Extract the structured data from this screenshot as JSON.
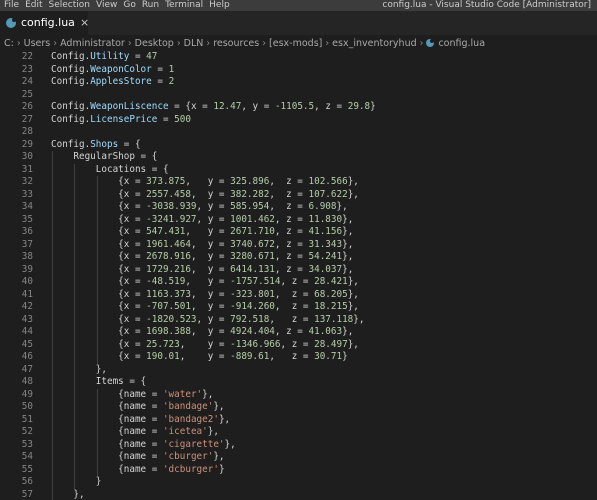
{
  "menu": [
    "File",
    "Edit",
    "Selection",
    "View",
    "Go",
    "Run",
    "Terminal",
    "Help"
  ],
  "window_title": "config.lua - Visual Studio Code [Administrator]",
  "tab": {
    "label": "config.lua",
    "close": "×"
  },
  "breadcrumb": [
    "C:",
    "Users",
    "Administrator",
    "Desktop",
    "DLN",
    "resources",
    "[esx-mods]",
    "esx_inventoryhud",
    "config.lua"
  ],
  "code_lines": [
    {
      "n": "22",
      "code": [
        [
          "k",
          "Config."
        ],
        [
          "p",
          "Utility"
        ],
        [
          "k",
          " = "
        ],
        [
          "n",
          "47"
        ]
      ]
    },
    {
      "n": "23",
      "code": [
        [
          "k",
          "Config."
        ],
        [
          "p",
          "WeaponColor"
        ],
        [
          "k",
          " = "
        ],
        [
          "n",
          "1"
        ]
      ]
    },
    {
      "n": "24",
      "code": [
        [
          "k",
          "Config."
        ],
        [
          "p",
          "ApplesStore"
        ],
        [
          "k",
          " = "
        ],
        [
          "n",
          "2"
        ]
      ]
    },
    {
      "n": "25",
      "code": []
    },
    {
      "n": "26",
      "code": [
        [
          "k",
          "Config."
        ],
        [
          "p",
          "WeaponLiscence"
        ],
        [
          "k",
          " = {x = "
        ],
        [
          "n",
          "12.47"
        ],
        [
          "k",
          ", y = "
        ],
        [
          "n",
          "-1105.5"
        ],
        [
          "k",
          ", z = "
        ],
        [
          "n",
          "29.8"
        ],
        [
          "k",
          "}"
        ]
      ]
    },
    {
      "n": "27",
      "code": [
        [
          "k",
          "Config."
        ],
        [
          "p",
          "LicensePrice"
        ],
        [
          "k",
          " = "
        ],
        [
          "n",
          "500"
        ]
      ]
    },
    {
      "n": "28",
      "code": []
    },
    {
      "n": "29",
      "code": [
        [
          "k",
          "Config."
        ],
        [
          "p",
          "Shops"
        ],
        [
          "k",
          " = {"
        ]
      ]
    },
    {
      "n": "30",
      "code": [
        [
          "k",
          "    RegularShop = {"
        ]
      ]
    },
    {
      "n": "31",
      "code": [
        [
          "k",
          "        Locations = {"
        ]
      ]
    },
    {
      "n": "32",
      "code": [
        [
          "k",
          "            {x = "
        ],
        [
          "n",
          "373.875"
        ],
        [
          "k",
          ",   y = "
        ],
        [
          "n",
          "325.896"
        ],
        [
          "k",
          ",  z = "
        ],
        [
          "n",
          "102.566"
        ],
        [
          "k",
          "},"
        ]
      ]
    },
    {
      "n": "33",
      "code": [
        [
          "k",
          "            {x = "
        ],
        [
          "n",
          "2557.458"
        ],
        [
          "k",
          ",  y = "
        ],
        [
          "n",
          "382.282"
        ],
        [
          "k",
          ",  z = "
        ],
        [
          "n",
          "107.622"
        ],
        [
          "k",
          "},"
        ]
      ]
    },
    {
      "n": "34",
      "code": [
        [
          "k",
          "            {x = "
        ],
        [
          "n",
          "-3038.939"
        ],
        [
          "k",
          ", y = "
        ],
        [
          "n",
          "585.954"
        ],
        [
          "k",
          ",  z = "
        ],
        [
          "n",
          "6.908"
        ],
        [
          "k",
          "},"
        ]
      ]
    },
    {
      "n": "35",
      "code": [
        [
          "k",
          "            {x = "
        ],
        [
          "n",
          "-3241.927"
        ],
        [
          "k",
          ", y = "
        ],
        [
          "n",
          "1001.462"
        ],
        [
          "k",
          ", z = "
        ],
        [
          "n",
          "11.830"
        ],
        [
          "k",
          "},"
        ]
      ]
    },
    {
      "n": "36",
      "code": [
        [
          "k",
          "            {x = "
        ],
        [
          "n",
          "547.431"
        ],
        [
          "k",
          ",   y = "
        ],
        [
          "n",
          "2671.710"
        ],
        [
          "k",
          ", z = "
        ],
        [
          "n",
          "41.156"
        ],
        [
          "k",
          "},"
        ]
      ]
    },
    {
      "n": "37",
      "code": [
        [
          "k",
          "            {x = "
        ],
        [
          "n",
          "1961.464"
        ],
        [
          "k",
          ",  y = "
        ],
        [
          "n",
          "3740.672"
        ],
        [
          "k",
          ", z = "
        ],
        [
          "n",
          "31.343"
        ],
        [
          "k",
          "},"
        ]
      ]
    },
    {
      "n": "38",
      "code": [
        [
          "k",
          "            {x = "
        ],
        [
          "n",
          "2678.916"
        ],
        [
          "k",
          ",  y = "
        ],
        [
          "n",
          "3280.671"
        ],
        [
          "k",
          ", z = "
        ],
        [
          "n",
          "54.241"
        ],
        [
          "k",
          "},"
        ]
      ]
    },
    {
      "n": "39",
      "code": [
        [
          "k",
          "            {x = "
        ],
        [
          "n",
          "1729.216"
        ],
        [
          "k",
          ",  y = "
        ],
        [
          "n",
          "6414.131"
        ],
        [
          "k",
          ", z = "
        ],
        [
          "n",
          "34.037"
        ],
        [
          "k",
          "},"
        ]
      ]
    },
    {
      "n": "40",
      "code": [
        [
          "k",
          "            {x = "
        ],
        [
          "n",
          "-48.519"
        ],
        [
          "k",
          ",   y = "
        ],
        [
          "n",
          "-1757.514"
        ],
        [
          "k",
          ", z = "
        ],
        [
          "n",
          "28.421"
        ],
        [
          "k",
          "},"
        ]
      ]
    },
    {
      "n": "41",
      "code": [
        [
          "k",
          "            {x = "
        ],
        [
          "n",
          "1163.373"
        ],
        [
          "k",
          ",  y = "
        ],
        [
          "n",
          "-323.801"
        ],
        [
          "k",
          ",  z = "
        ],
        [
          "n",
          "68.205"
        ],
        [
          "k",
          "},"
        ]
      ]
    },
    {
      "n": "42",
      "code": [
        [
          "k",
          "            {x = "
        ],
        [
          "n",
          "-707.501"
        ],
        [
          "k",
          ",  y = "
        ],
        [
          "n",
          "-914.260"
        ],
        [
          "k",
          ",  z = "
        ],
        [
          "n",
          "18.215"
        ],
        [
          "k",
          "},"
        ]
      ]
    },
    {
      "n": "43",
      "code": [
        [
          "k",
          "            {x = "
        ],
        [
          "n",
          "-1820.523"
        ],
        [
          "k",
          ", y = "
        ],
        [
          "n",
          "792.518"
        ],
        [
          "k",
          ",   z = "
        ],
        [
          "n",
          "137.118"
        ],
        [
          "k",
          "},"
        ]
      ]
    },
    {
      "n": "44",
      "code": [
        [
          "k",
          "            {x = "
        ],
        [
          "n",
          "1698.388"
        ],
        [
          "k",
          ",  y = "
        ],
        [
          "n",
          "4924.404"
        ],
        [
          "k",
          ", z = "
        ],
        [
          "n",
          "41.063"
        ],
        [
          "k",
          "},"
        ]
      ]
    },
    {
      "n": "45",
      "code": [
        [
          "k",
          "            {x = "
        ],
        [
          "n",
          "25.723"
        ],
        [
          "k",
          ",    y = "
        ],
        [
          "n",
          "-1346.966"
        ],
        [
          "k",
          ", z = "
        ],
        [
          "n",
          "28.497"
        ],
        [
          "k",
          "},"
        ]
      ]
    },
    {
      "n": "46",
      "code": [
        [
          "k",
          "            {x = "
        ],
        [
          "n",
          "190.01"
        ],
        [
          "k",
          ",    y = "
        ],
        [
          "n",
          "-889.61"
        ],
        [
          "k",
          ",   z = "
        ],
        [
          "n",
          "30.71"
        ],
        [
          "k",
          "}"
        ]
      ]
    },
    {
      "n": "47",
      "code": [
        [
          "k",
          "        },"
        ]
      ]
    },
    {
      "n": "48",
      "code": [
        [
          "k",
          "        Items = {"
        ]
      ]
    },
    {
      "n": "49",
      "code": [
        [
          "k",
          "            {name = "
        ],
        [
          "s",
          "'water'"
        ],
        [
          "k",
          "},"
        ]
      ]
    },
    {
      "n": "50",
      "code": [
        [
          "k",
          "            {name = "
        ],
        [
          "s",
          "'bandage'"
        ],
        [
          "k",
          "},"
        ]
      ]
    },
    {
      "n": "51",
      "code": [
        [
          "k",
          "            {name = "
        ],
        [
          "s",
          "'bandage2'"
        ],
        [
          "k",
          "},"
        ]
      ]
    },
    {
      "n": "52",
      "code": [
        [
          "k",
          "            {name = "
        ],
        [
          "s",
          "'icetea'"
        ],
        [
          "k",
          "},"
        ]
      ]
    },
    {
      "n": "53",
      "code": [
        [
          "k",
          "            {name = "
        ],
        [
          "s",
          "'cigarette'"
        ],
        [
          "k",
          "},"
        ]
      ]
    },
    {
      "n": "54",
      "code": [
        [
          "k",
          "            {name = "
        ],
        [
          "s",
          "'cburger'"
        ],
        [
          "k",
          "},"
        ]
      ]
    },
    {
      "n": "55",
      "code": [
        [
          "k",
          "            {name = "
        ],
        [
          "s",
          "'dcburger'"
        ],
        [
          "k",
          "}"
        ]
      ]
    },
    {
      "n": "56",
      "code": [
        [
          "k",
          "        }"
        ]
      ]
    },
    {
      "n": "57",
      "code": [
        [
          "k",
          "    },"
        ]
      ]
    },
    {
      "n": "58",
      "code": []
    }
  ]
}
